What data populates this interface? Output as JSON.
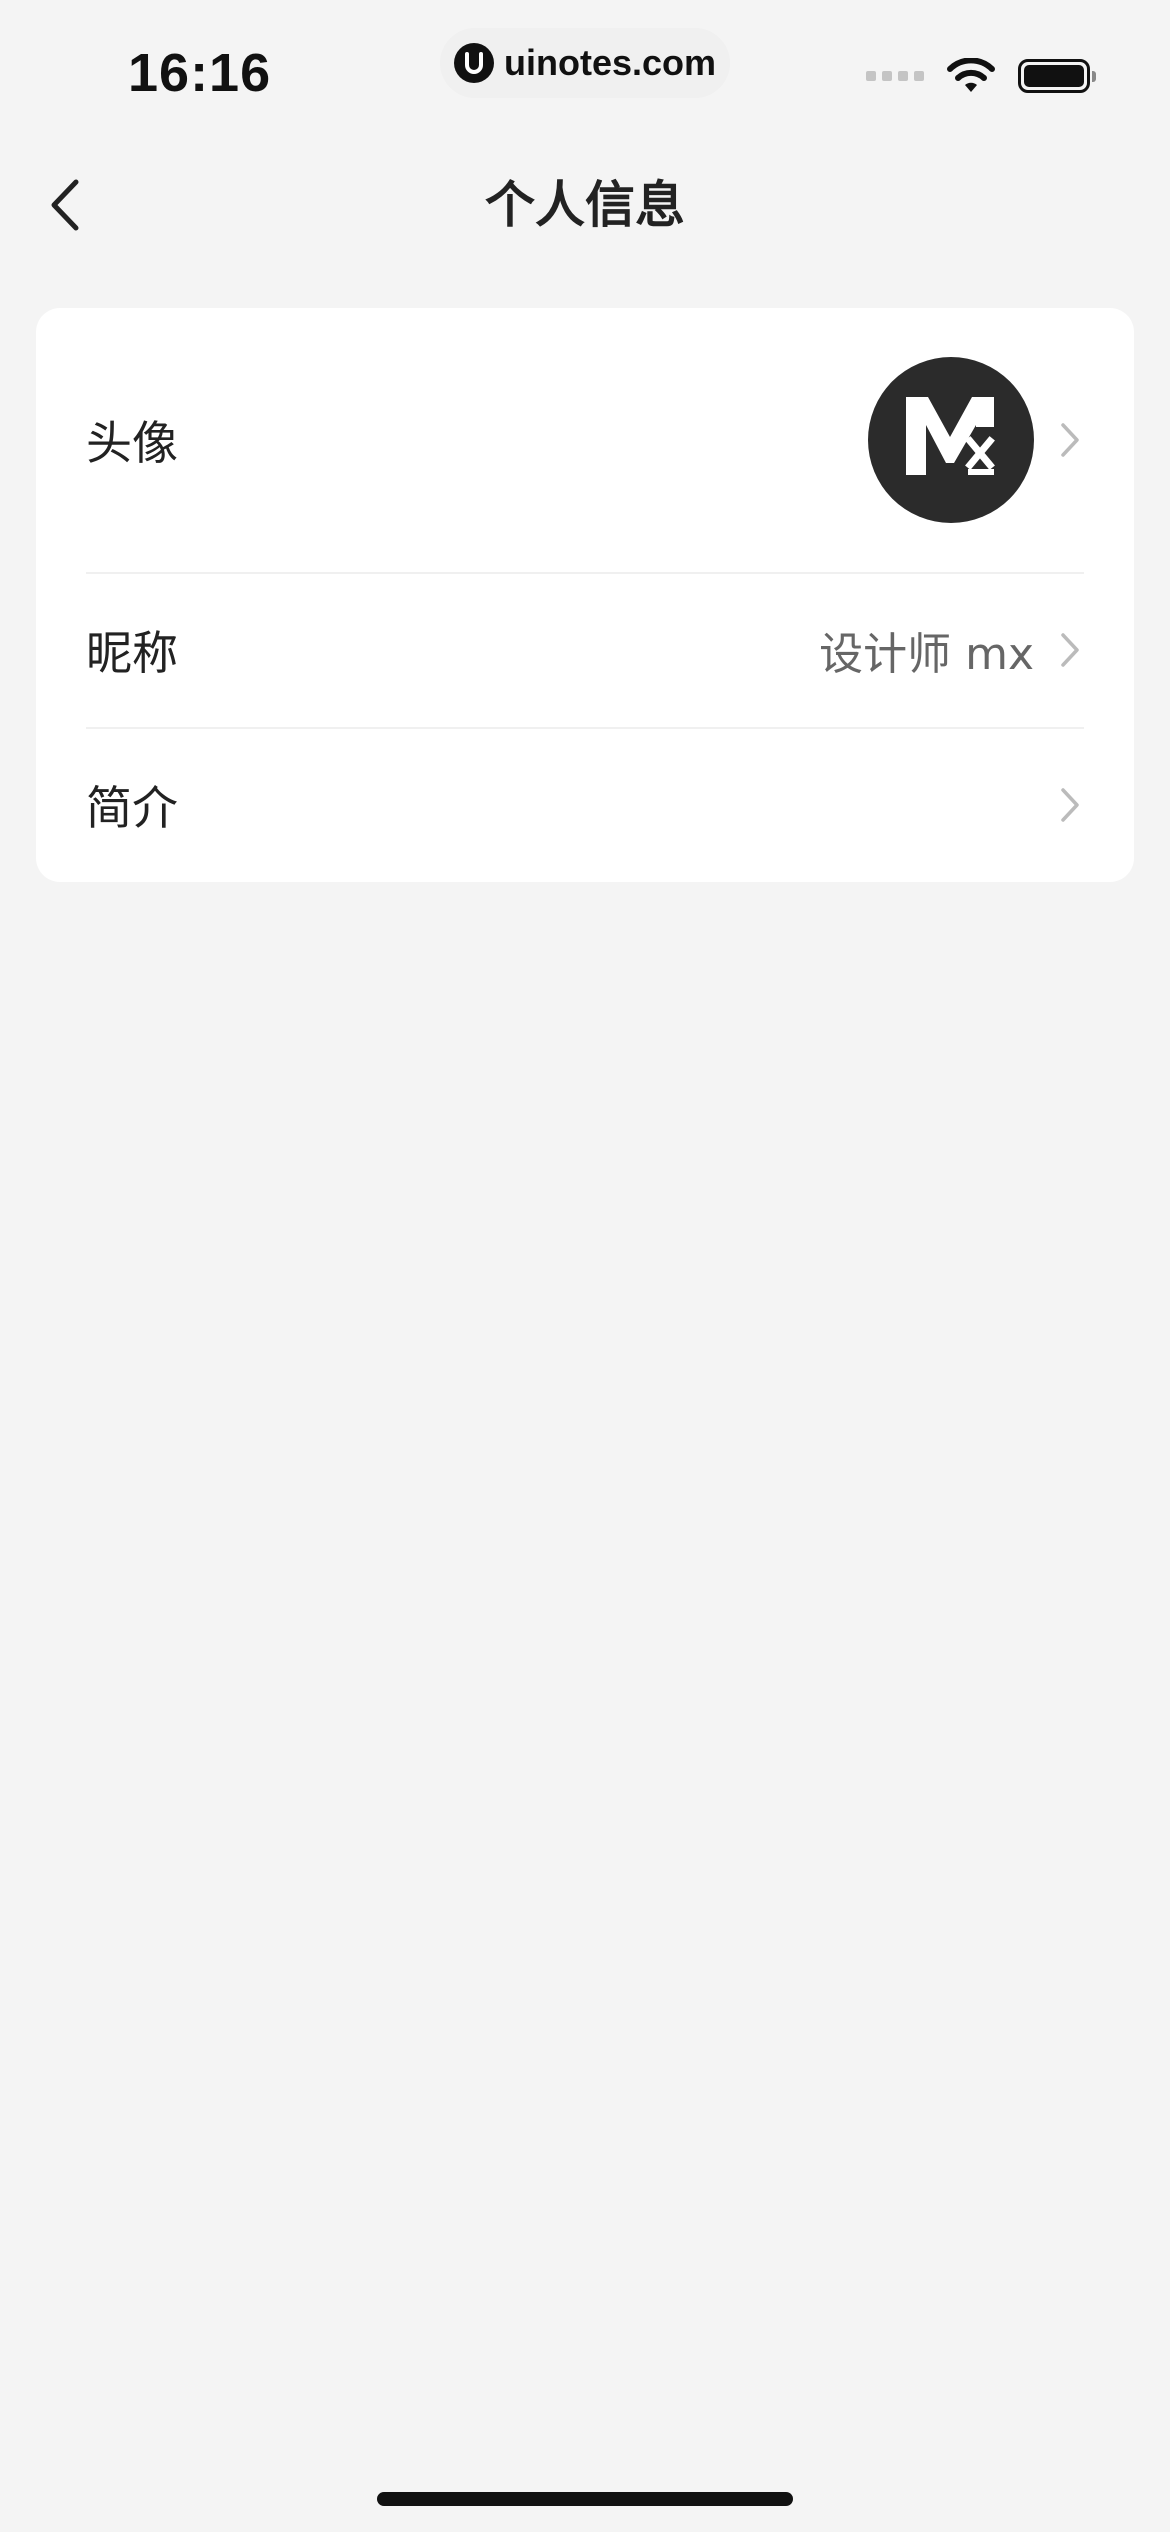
{
  "status_bar": {
    "time": "16:16",
    "url": "uinotes.com",
    "icons": [
      "signal-icon",
      "wifi-icon",
      "battery-icon"
    ]
  },
  "nav": {
    "title": "个人信息",
    "back_icon": "chevron-left-icon"
  },
  "profile": {
    "rows": [
      {
        "label": "头像",
        "value": "",
        "type": "avatar"
      },
      {
        "label": "昵称",
        "value": "设计师 mx",
        "type": "text"
      },
      {
        "label": "简介",
        "value": "",
        "type": "text"
      }
    ]
  },
  "colors": {
    "background": "#f4f4f4",
    "card": "#ffffff",
    "avatar_bg": "#2b2b2b",
    "text_primary": "#222222",
    "text_secondary": "#666666",
    "chevron": "#bbbbbb"
  }
}
